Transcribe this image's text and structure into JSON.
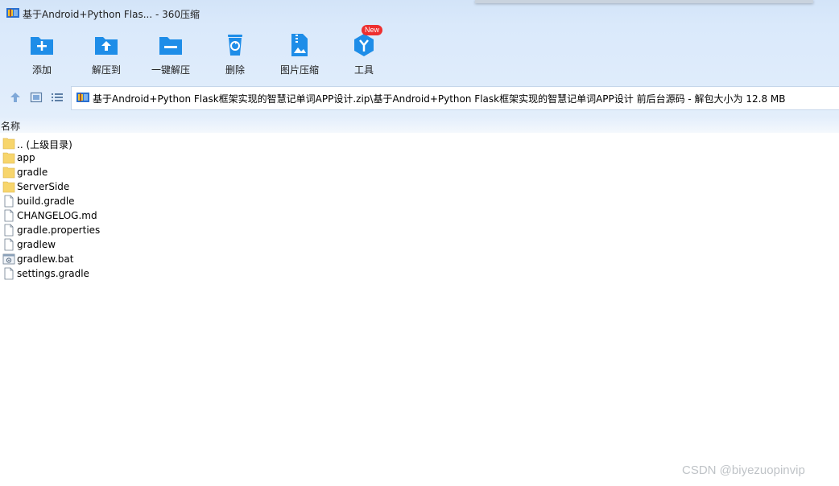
{
  "window": {
    "title": "基于Android+Python Flas... - 360压缩"
  },
  "toolbar": {
    "items": [
      {
        "label": "添加",
        "icon": "add-folder-icon"
      },
      {
        "label": "解压到",
        "icon": "extract-to-icon"
      },
      {
        "label": "一键解压",
        "icon": "one-click-extract-icon"
      },
      {
        "label": "删除",
        "icon": "delete-bin-icon"
      },
      {
        "label": "图片压缩",
        "icon": "image-compress-icon"
      },
      {
        "label": "工具",
        "icon": "tools-icon",
        "badge": "New"
      }
    ]
  },
  "address": {
    "path": "基于Android+Python Flask框架实现的智慧记单词APP设计.zip\\基于Android+Python Flask框架实现的智慧记单词APP设计 前后台源码 - 解包大小为 12.8 MB"
  },
  "file_list": {
    "column_header": "名称",
    "items": [
      {
        "name": ".. (上级目录)",
        "type": "folder"
      },
      {
        "name": "app",
        "type": "folder"
      },
      {
        "name": "gradle",
        "type": "folder"
      },
      {
        "name": "ServerSide",
        "type": "folder"
      },
      {
        "name": "build.gradle",
        "type": "file"
      },
      {
        "name": "CHANGELOG.md",
        "type": "file"
      },
      {
        "name": "gradle.properties",
        "type": "file"
      },
      {
        "name": "gradlew",
        "type": "file"
      },
      {
        "name": "gradlew.bat",
        "type": "bat"
      },
      {
        "name": "settings.gradle",
        "type": "file"
      }
    ]
  },
  "watermark": "CSDN @biyezuopinvip",
  "colors": {
    "accent": "#1e8de8",
    "badge": "#ee2f2f",
    "folder": "#f7d56c"
  }
}
